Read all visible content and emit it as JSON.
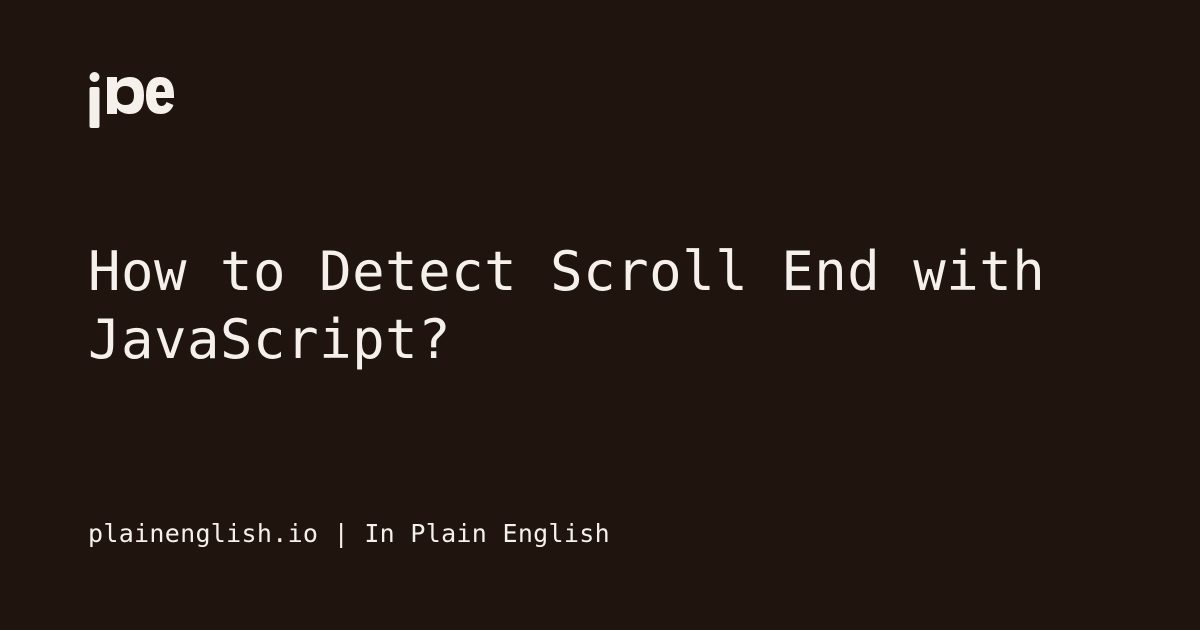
{
  "logo": {
    "name": "ipe-logo"
  },
  "title": "How to Detect Scroll End with JavaScript?",
  "footer": "plainenglish.io | In Plain English",
  "colors": {
    "background": "#20140f",
    "text": "#f5f0eb"
  }
}
